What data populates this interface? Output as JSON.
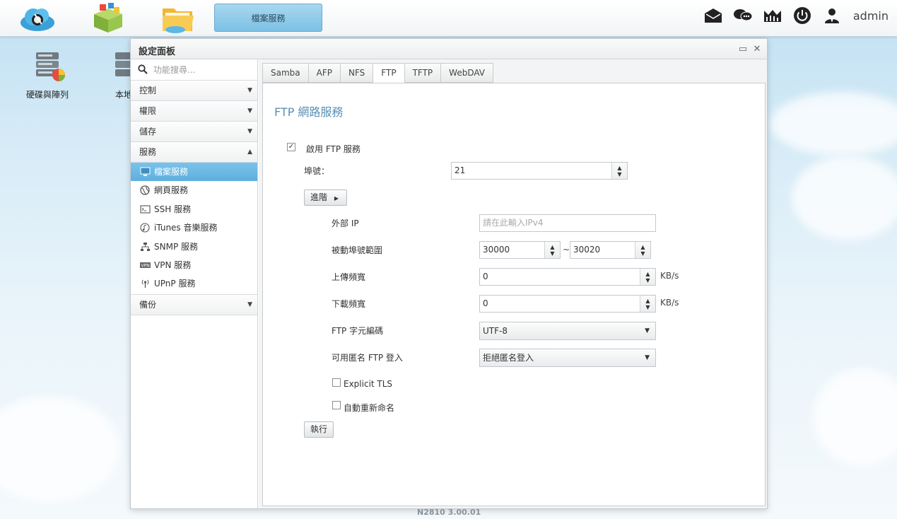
{
  "topbar": {
    "active_app": "檔案服務",
    "user": "admin"
  },
  "desktop": {
    "icons": [
      {
        "label": "硬碟與陣列"
      },
      {
        "label": "本地"
      }
    ]
  },
  "window": {
    "title": "設定面板",
    "restore_icon": "▭",
    "close_icon": "✕"
  },
  "sidebar": {
    "search_placeholder": "功能搜尋...",
    "categories": [
      {
        "label": "控制",
        "arrow": "▼"
      },
      {
        "label": "權限",
        "arrow": "▼"
      },
      {
        "label": "儲存",
        "arrow": "▼"
      },
      {
        "label": "服務",
        "arrow": "▲"
      },
      {
        "label": "備份",
        "arrow": "▼"
      }
    ],
    "service_items": [
      {
        "label": "檔案服務",
        "icon": "monitor-icon"
      },
      {
        "label": "網頁服務",
        "icon": "globe-icon"
      },
      {
        "label": "SSH 服務",
        "icon": "terminal-icon"
      },
      {
        "label": "iTunes 音樂服務",
        "icon": "music-icon"
      },
      {
        "label": "SNMP 服務",
        "icon": "network-icon"
      },
      {
        "label": "VPN 服務",
        "icon": "vpn-icon"
      },
      {
        "label": "UPnP 服務",
        "icon": "antenna-icon"
      }
    ]
  },
  "tabs": [
    "Samba",
    "AFP",
    "NFS",
    "FTP",
    "TFTP",
    "WebDAV"
  ],
  "ftp": {
    "title": "FTP 網路服務",
    "enable_label": "啟用 FTP 服務",
    "enable_checked": "✓",
    "port_label": "埠號：",
    "port_value": "21",
    "advanced_label": "進階",
    "advanced_arrow": "▶",
    "external_ip_label": "外部 IP",
    "external_ip_placeholder": "請在此輸入IPv4",
    "passive_label": "被動埠號範圍",
    "passive_from": "30000",
    "passive_sep": "~",
    "passive_to": "30020",
    "upload_label": "上傳頻寬",
    "upload_value": "0",
    "upload_unit": "KB/s",
    "download_label": "下載頻寬",
    "download_value": "0",
    "download_unit": "KB/s",
    "charset_label": "FTP 字元編碼",
    "charset_value": "UTF-8",
    "anon_label": "可用匿名 FTP 登入",
    "anon_value": "拒絕匿名登入",
    "tls_label": "Explicit TLS",
    "rename_label": "自動重新命名",
    "apply_label": "執行"
  },
  "footer": {
    "version": "N2810   3.00.01"
  },
  "colors": {
    "accent": "#5eafde",
    "title_blue": "#5a8fb5"
  }
}
